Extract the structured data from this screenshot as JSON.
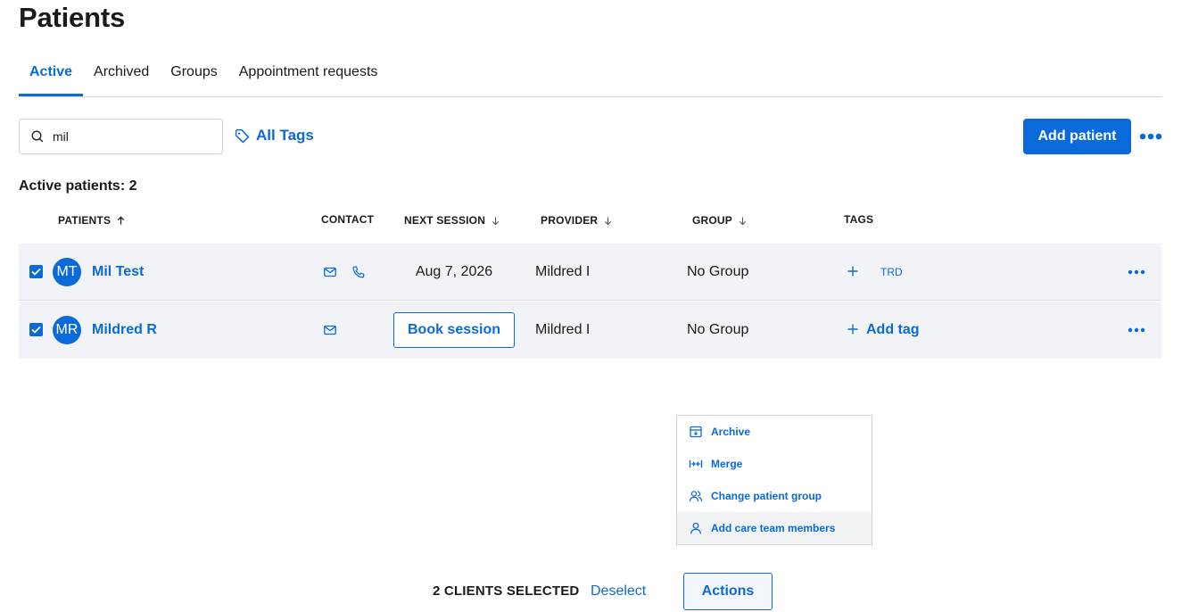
{
  "page": {
    "title": "Patients"
  },
  "tabs": [
    {
      "label": "Active"
    },
    {
      "label": "Archived"
    },
    {
      "label": "Groups"
    },
    {
      "label": "Appointment requests"
    }
  ],
  "toolbar": {
    "search_value": "mil",
    "all_tags_label": "All Tags",
    "add_patient_label": "Add patient"
  },
  "summary": {
    "count_label": "Active patients: 2"
  },
  "columns": {
    "patients": "PATIENTS",
    "contact": "CONTACT",
    "next_session": "NEXT SESSION",
    "provider": "PROVIDER",
    "group": "GROUP",
    "tags": "TAGS"
  },
  "rows": [
    {
      "initials": "MT",
      "name": "Mil Test",
      "next_session": "Aug 7, 2026",
      "provider": "Mildred I",
      "group": "No Group",
      "tag": "TRD"
    },
    {
      "initials": "MR",
      "name": "Mildred R",
      "book_label": "Book session",
      "provider": "Mildred I",
      "group": "No Group",
      "add_tag_label": "Add tag"
    }
  ],
  "actions_menu": {
    "items": [
      {
        "label": "Archive",
        "icon": "archive-icon"
      },
      {
        "label": "Merge",
        "icon": "merge-icon"
      },
      {
        "label": "Change patient group",
        "icon": "users-icon"
      },
      {
        "label": "Add care team members",
        "icon": "user-icon"
      }
    ]
  },
  "selection_bar": {
    "selected_label": "2 CLIENTS SELECTED",
    "deselect_label": "Deselect",
    "actions_label": "Actions"
  },
  "colors": {
    "accent": "#0a6ad9",
    "row_bg": "#f1f3f6"
  }
}
